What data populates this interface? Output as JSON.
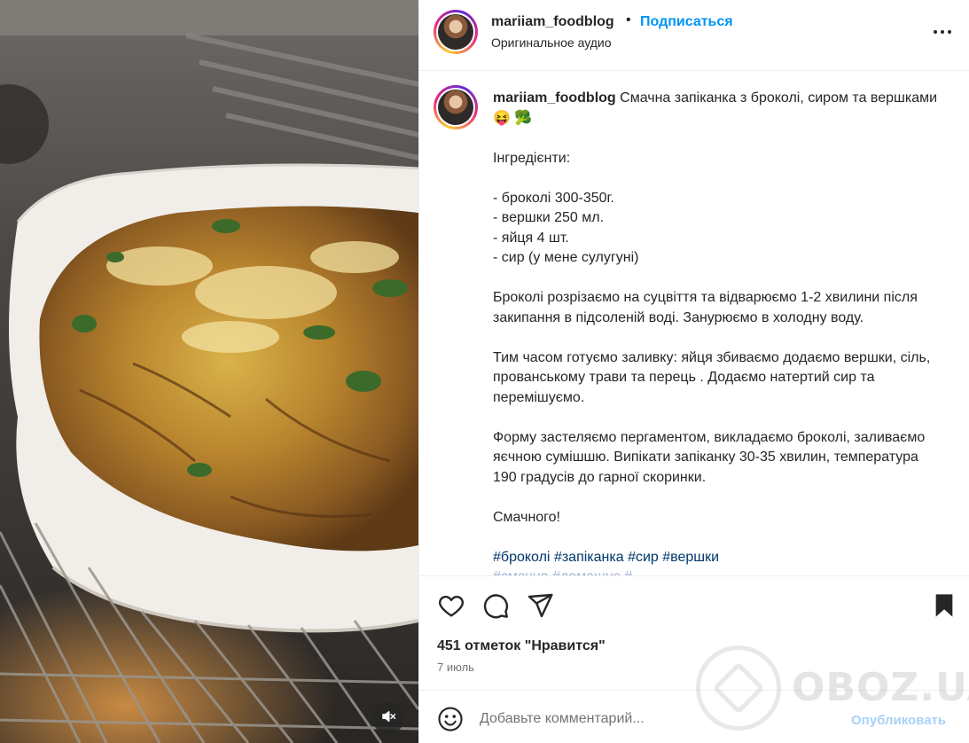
{
  "header": {
    "username": "mariiam_foodblog",
    "separator": "•",
    "follow_label": "Подписаться",
    "audio_label": "Оригинальное аудио"
  },
  "caption": {
    "username": "mariiam_foodblog",
    "title": "Смачна запіканка з броколі, сиром та вершками 😝 🥦",
    "ingredients_heading": "Інгредієнти:",
    "ingredients": [
      "- броколі 300-350г.",
      "- вершки 250 мл.",
      "- яйця 4 шт.",
      "- сир (у мене сулугуні)"
    ],
    "step1": "Броколі розрізаємо на суцвіття та відварюємо 1-2 хвилини після закипання в підсоленій воді. Занурюємо в холодну воду.",
    "step2": "Тим часом готуємо заливку: яйця збиваємо додаємо вершки, сіль, прованському трави та перець . Додаємо натертий сир та перемішуємо.",
    "step3": "Форму застеляємо пергаментом, викладаємо броколі, заливаємо яєчною сумішшю. Випікати запіканку 30-35 хвилин, температура 190 градусів до гарної скоринки.",
    "closing": "Смачного!",
    "hashtags": [
      "#броколі",
      "#запіканка",
      "#сир",
      "#вершки"
    ],
    "hashtags_row2_partial": "#смачно #домашнє #..."
  },
  "actions": {
    "likes_text": "451 отметок \"Нравится\"",
    "date_text": "7 июль"
  },
  "comment": {
    "placeholder": "Добавьте комментарий...",
    "publish_label": "Опубликовать"
  },
  "watermark": {
    "text": "OBOZ.UA"
  },
  "icons": {
    "header": [
      "more-options-icon"
    ],
    "actions": [
      "heart-icon",
      "comment-icon",
      "share-icon",
      "bookmark-icon"
    ],
    "comment": [
      "emoji-icon"
    ],
    "media": [
      "muted-speaker-icon"
    ]
  },
  "colors": {
    "link": "#0095f6",
    "hashtag": "#00376b",
    "muted_text": "#737373",
    "publish_disabled": "#a8d3f7"
  }
}
